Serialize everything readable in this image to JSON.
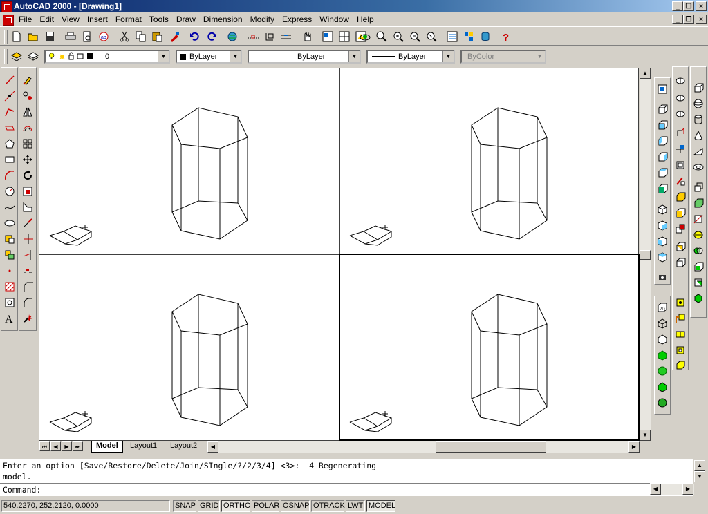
{
  "window": {
    "title": "AutoCAD 2000 - [Drawing1]",
    "minimize": "_",
    "restore": "❐",
    "close": "×"
  },
  "menu": [
    "File",
    "Edit",
    "View",
    "Insert",
    "Format",
    "Tools",
    "Draw",
    "Dimension",
    "Modify",
    "Express",
    "Window",
    "Help"
  ],
  "properties": {
    "layer": "0",
    "color": "ByLayer",
    "linetype": "ByLayer",
    "lineweight": "ByLayer",
    "plotstyle": "ByColor"
  },
  "tabs": {
    "model": "Model",
    "layout1": "Layout1",
    "layout2": "Layout2"
  },
  "command": {
    "line1": "Enter an option [Save/Restore/Delete/Join/SIngle/?/2/3/4] <3>: _4 Regenerating",
    "line2": "model.",
    "prompt": "Command:"
  },
  "status": {
    "coords": "540.2270, 252.2120, 0.0000",
    "snap": "SNAP",
    "grid": "GRID",
    "ortho": "ORTHO",
    "polar": "POLAR",
    "osnap": "OSNAP",
    "otrack": "OTRACK",
    "lwt": "LWT",
    "model": "MODEL"
  },
  "colors": {
    "title_start": "#0a246a",
    "title_end": "#a6caf0",
    "face": "#d4d0c8",
    "help": "#cc0000"
  }
}
